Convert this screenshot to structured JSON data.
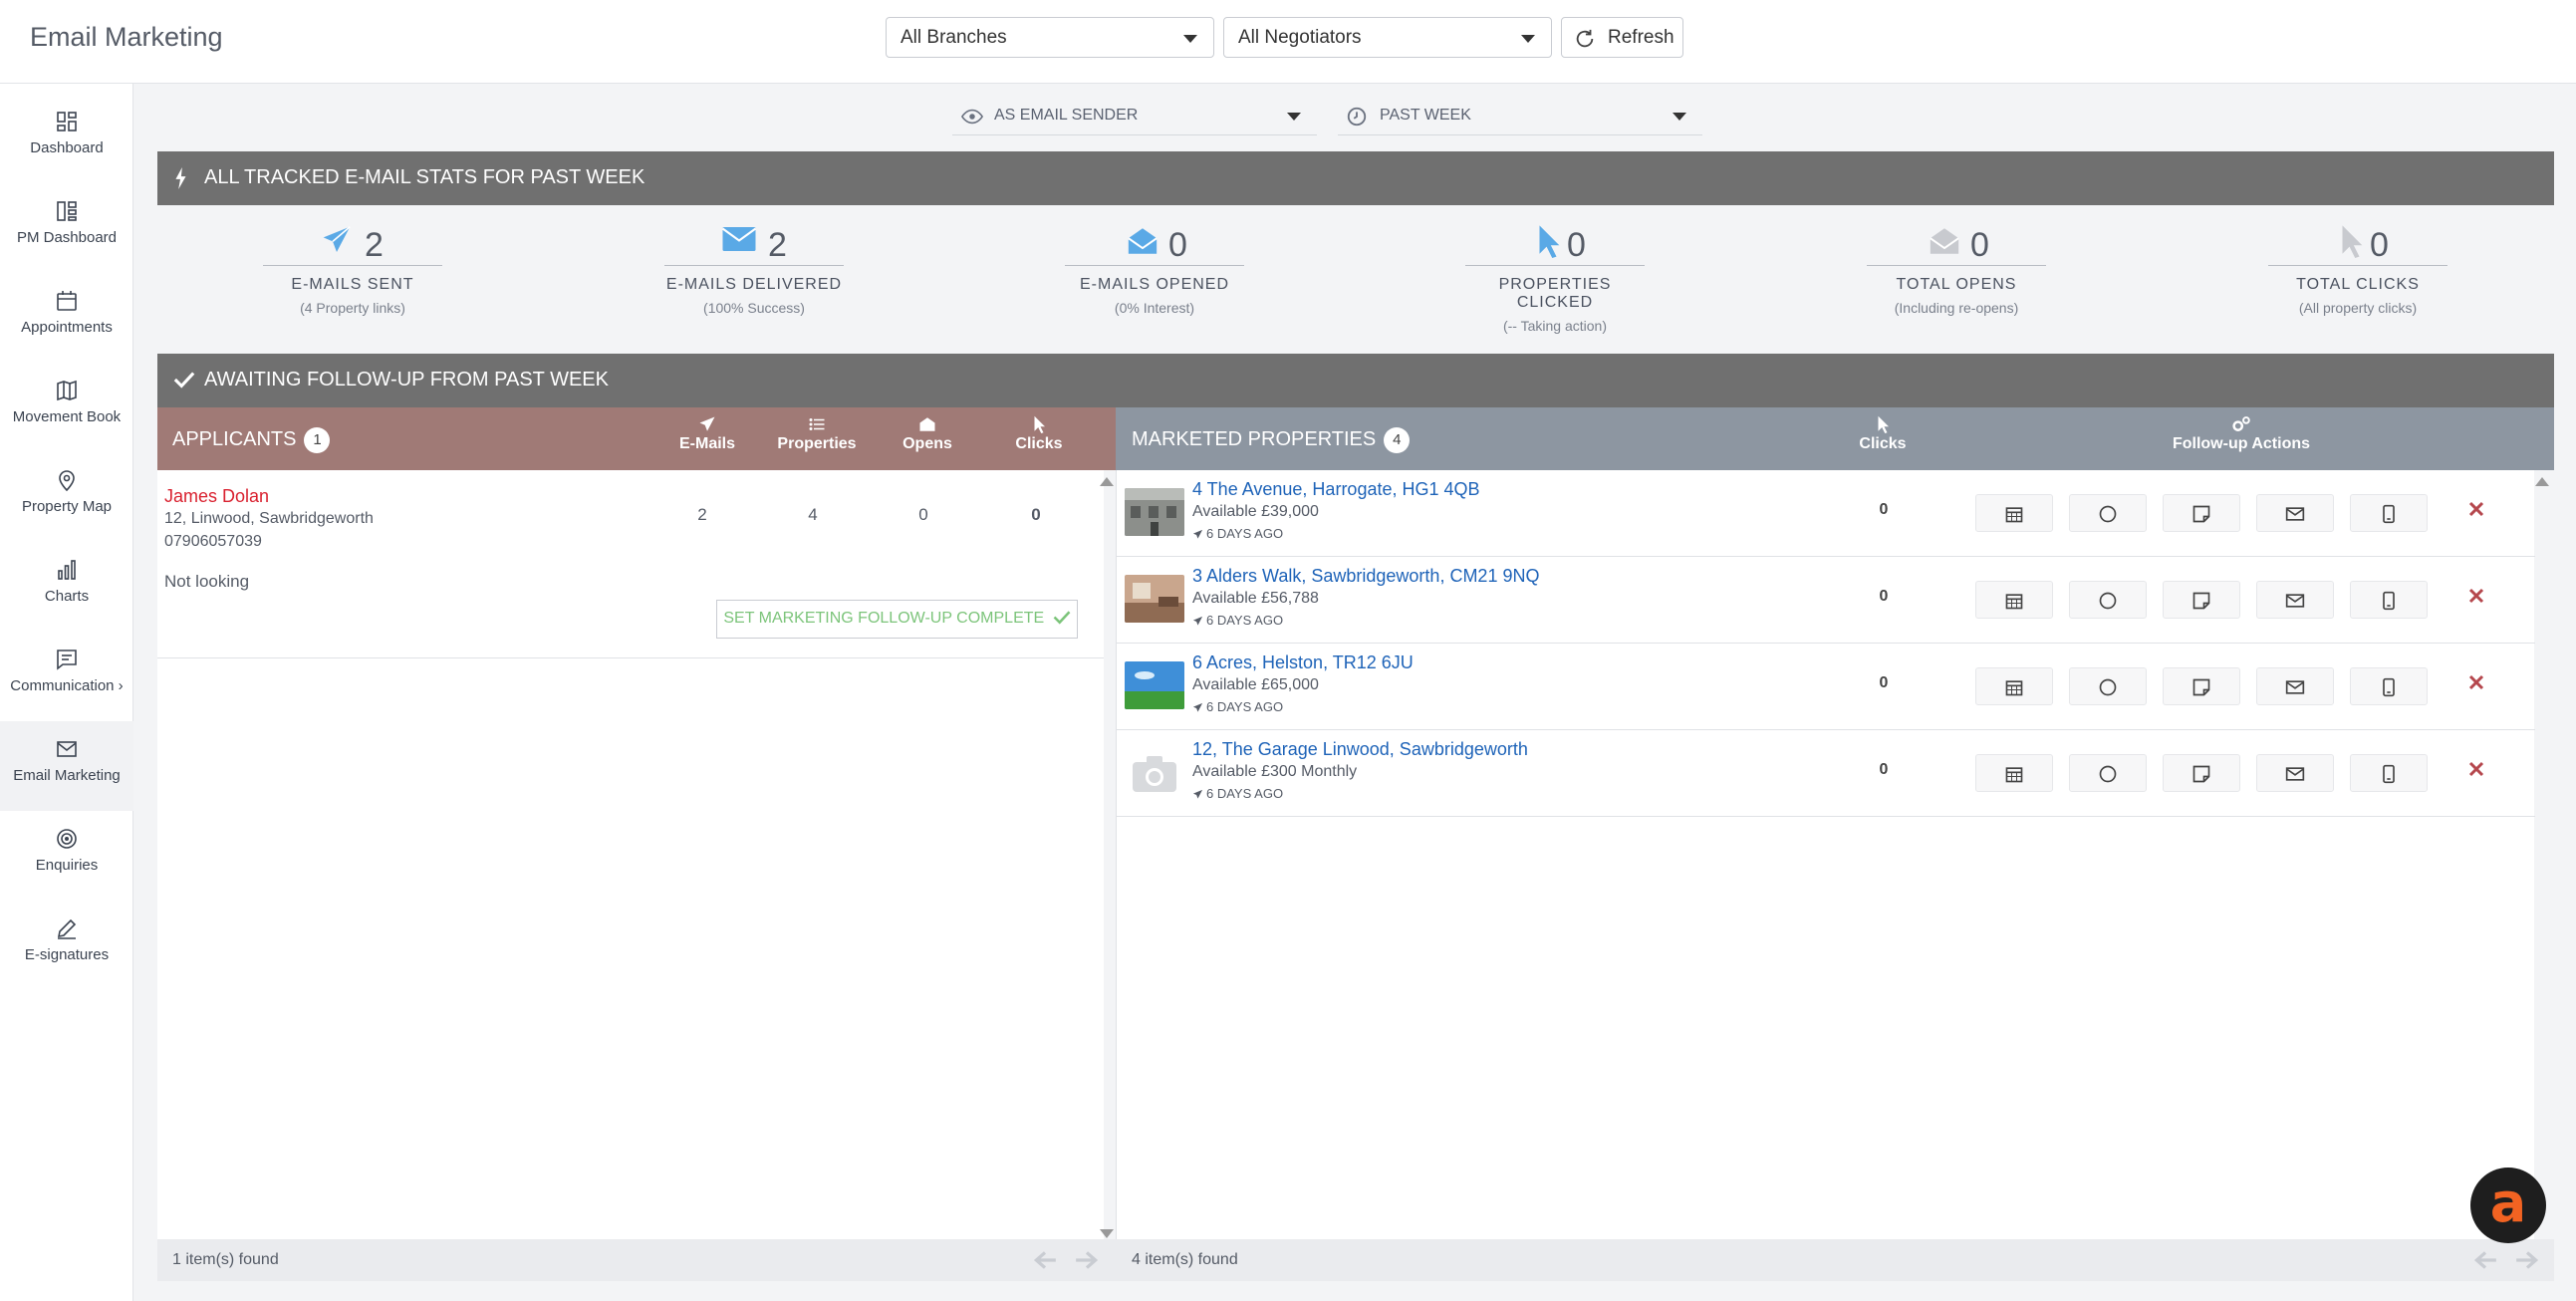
{
  "app": {
    "title": "Email Marketing"
  },
  "header": {
    "branch_select": "All Branches",
    "negotiator_select": "All Negotiators",
    "refresh_label": "Refresh"
  },
  "sidebar": {
    "items": [
      {
        "label": "Dashboard",
        "icon": "dashboard-icon"
      },
      {
        "label": "PM Dashboard",
        "icon": "pm-dashboard-icon"
      },
      {
        "label": "Appointments",
        "icon": "calendar-icon"
      },
      {
        "label": "Movement Book",
        "icon": "book-icon"
      },
      {
        "label": "Property Map",
        "icon": "map-pin-icon"
      },
      {
        "label": "Charts",
        "icon": "chart-icon"
      },
      {
        "label": "Communication",
        "icon": "communication-icon"
      },
      {
        "label": "Email Marketing",
        "icon": "envelope-icon",
        "active": true
      },
      {
        "label": "Enquiries",
        "icon": "target-icon"
      },
      {
        "label": "E-signatures",
        "icon": "pen-icon"
      }
    ]
  },
  "filters": {
    "view_as": "AS EMAIL SENDER",
    "period": "PAST WEEK"
  },
  "stats_section": {
    "title": "ALL TRACKED E-MAIL STATS FOR PAST WEEK",
    "stats": [
      {
        "value": "2",
        "label": "E-MAILS SENT",
        "sub": "(4 Property links)",
        "icon": "paper-plane-icon"
      },
      {
        "value": "2",
        "label": "E-MAILS DELIVERED",
        "sub": "(100% Success)",
        "icon": "envelope-icon"
      },
      {
        "value": "0",
        "label": "E-MAILS OPENED",
        "sub": "(0% Interest)",
        "icon": "envelope-open-icon"
      },
      {
        "value": "0",
        "label": "PROPERTIES CLICKED",
        "sub": "(-- Taking action)",
        "icon": "cursor-icon"
      },
      {
        "value": "0",
        "label": "TOTAL OPENS",
        "sub": "(Including re-opens)",
        "icon": "envelope-open-icon"
      },
      {
        "value": "0",
        "label": "TOTAL CLICKS",
        "sub": "(All property clicks)",
        "icon": "cursor-icon"
      }
    ]
  },
  "followup_section": {
    "title": "AWAITING FOLLOW-UP FROM PAST WEEK"
  },
  "applicants": {
    "title": "APPLICANTS",
    "count": "1",
    "columns": [
      "E-Mails",
      "Properties",
      "Opens",
      "Clicks"
    ],
    "rows": [
      {
        "name": "James Dolan",
        "address": "12, Linwood, Sawbridgeworth",
        "phone": "07906057039",
        "status": "Not looking",
        "emails": "2",
        "properties": "4",
        "opens": "0",
        "clicks": "0",
        "action_label": "SET MARKETING FOLLOW-UP COMPLETE"
      }
    ],
    "footer": "1 item(s) found"
  },
  "properties": {
    "title": "MARKETED PROPERTIES",
    "count": "4",
    "columns": {
      "clicks": "Clicks",
      "actions": "Follow-up Actions"
    },
    "rows": [
      {
        "address": "4 The Avenue, Harrogate, HG1 4QB",
        "price": "Available £39,000",
        "sent": "6 DAYS AGO",
        "clicks": "0"
      },
      {
        "address": "3 Alders Walk, Sawbridgeworth, CM21 9NQ",
        "price": "Available £56,788",
        "sent": "6 DAYS AGO",
        "clicks": "0"
      },
      {
        "address": "6 Acres, Helston, TR12 6JU",
        "price": "Available £65,000",
        "sent": "6 DAYS AGO",
        "clicks": "0"
      },
      {
        "address": "12, The Garage Linwood, Sawbridgeworth",
        "price": "Available £300 Monthly",
        "sent": "6 DAYS AGO",
        "clicks": "0"
      }
    ],
    "action_icons": [
      "calendar-icon",
      "circle-icon",
      "note-icon",
      "envelope-icon",
      "mobile-icon",
      "delete-icon"
    ],
    "footer": "4 item(s) found"
  },
  "fab": {
    "label": "a"
  }
}
